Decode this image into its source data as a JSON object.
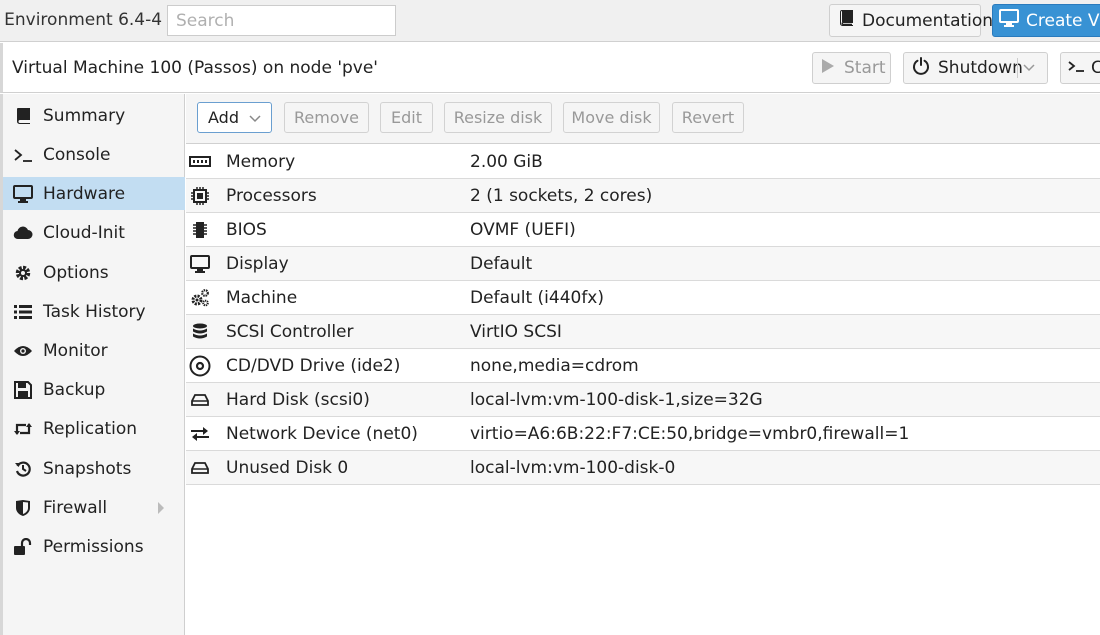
{
  "topbar": {
    "app_title": "l Environment 6.4-4",
    "search_placeholder": "Search",
    "documentation_label": "Documentation",
    "create_vm_label": "Create VM"
  },
  "header": {
    "title": "Virtual Machine 100 (Passos) on node 'pve'",
    "start_label": "Start",
    "shutdown_label": "Shutdown",
    "console_label": "C"
  },
  "sidebar": {
    "items": [
      {
        "label": "Summary",
        "icon": "book-icon"
      },
      {
        "label": "Console",
        "icon": "terminal-icon"
      },
      {
        "label": "Hardware",
        "icon": "monitor-icon",
        "active": true
      },
      {
        "label": "Cloud-Init",
        "icon": "cloud-icon"
      },
      {
        "label": "Options",
        "icon": "gear-icon"
      },
      {
        "label": "Task History",
        "icon": "list-icon"
      },
      {
        "label": "Monitor",
        "icon": "eye-icon"
      },
      {
        "label": "Backup",
        "icon": "floppy-icon"
      },
      {
        "label": "Replication",
        "icon": "retweet-icon"
      },
      {
        "label": "Snapshots",
        "icon": "history-icon"
      },
      {
        "label": "Firewall",
        "icon": "shield-icon"
      },
      {
        "label": "Permissions",
        "icon": "unlock-icon"
      }
    ]
  },
  "toolbar": {
    "add_label": "Add",
    "remove_label": "Remove",
    "edit_label": "Edit",
    "resize_label": "Resize disk",
    "move_label": "Move disk",
    "revert_label": "Revert"
  },
  "hardware": [
    {
      "name": "Memory",
      "value": "2.00 GiB",
      "icon": "memory-icon"
    },
    {
      "name": "Processors",
      "value": "2 (1 sockets, 2 cores)",
      "icon": "cpu-icon"
    },
    {
      "name": "BIOS",
      "value": "OVMF (UEFI)",
      "icon": "chip-icon"
    },
    {
      "name": "Display",
      "value": "Default",
      "icon": "display-icon"
    },
    {
      "name": "Machine",
      "value": "Default (i440fx)",
      "icon": "cogs-icon"
    },
    {
      "name": "SCSI Controller",
      "value": "VirtIO SCSI",
      "icon": "database-icon"
    },
    {
      "name": "CD/DVD Drive (ide2)",
      "value": "none,media=cdrom",
      "icon": "cdrom-icon"
    },
    {
      "name": "Hard Disk (scsi0)",
      "value": "local-lvm:vm-100-disk-1,size=32G",
      "icon": "hdd-icon"
    },
    {
      "name": "Network Device (net0)",
      "value": "virtio=A6:6B:22:F7:CE:50,bridge=vmbr0,firewall=1",
      "icon": "exchange-icon"
    },
    {
      "name": "Unused Disk 0",
      "value": "local-lvm:vm-100-disk-0",
      "icon": "hdd-icon"
    }
  ],
  "colors": {
    "accent": "#3892d4",
    "selection": "#c2ddf2"
  }
}
